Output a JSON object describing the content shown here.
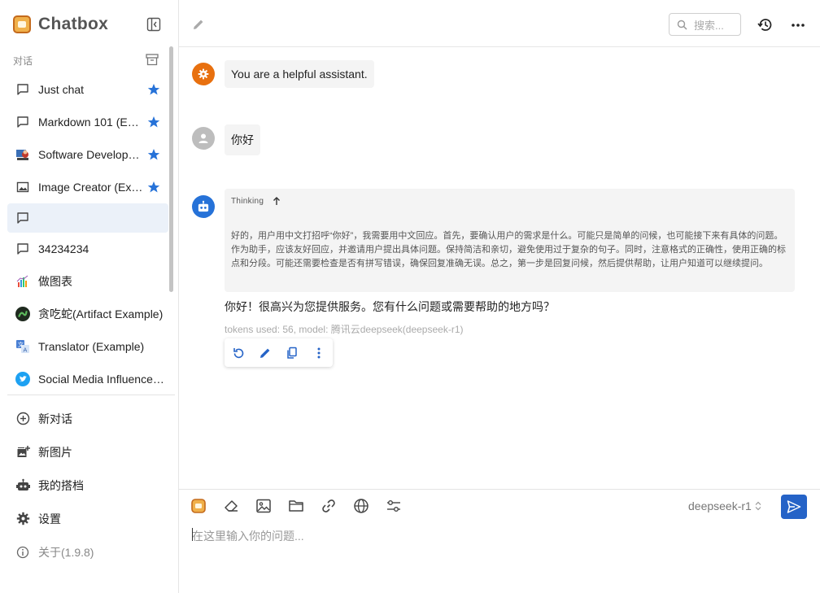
{
  "app": {
    "name": "Chatbox"
  },
  "sidebar": {
    "section_label": "对话",
    "conversations": [
      {
        "label": "Just chat",
        "icon": "chat-bubble-icon",
        "starred": true
      },
      {
        "label": "Markdown 101 (Example)",
        "icon": "chat-bubble-icon",
        "starred": true
      },
      {
        "label": "Software Developer (Example)",
        "icon": "developer-avatar-icon",
        "starred": true
      },
      {
        "label": "Image Creator (Example)",
        "icon": "image-icon",
        "starred": true
      },
      {
        "label": "",
        "icon": "chat-bubble-icon",
        "starred": false,
        "active": true
      },
      {
        "label": "34234234",
        "icon": "chat-bubble-icon",
        "starred": false
      },
      {
        "label": "做图表",
        "icon": "chart-avatar-icon",
        "starred": false
      },
      {
        "label": "贪吃蛇(Artifact Example)",
        "icon": "snake-avatar-icon",
        "starred": false
      },
      {
        "label": "Translator (Example)",
        "icon": "translator-avatar-icon",
        "starred": false
      },
      {
        "label": "Social Media Influencer (Example)",
        "icon": "twitter-avatar-icon",
        "starred": false
      }
    ],
    "menu": {
      "new_chat": "新对话",
      "new_image": "新图片",
      "my_copilots": "我的搭档",
      "settings": "设置",
      "about": "关于(1.9.8)"
    }
  },
  "header": {
    "search_placeholder": "搜索..."
  },
  "messages": {
    "system": "You are a helpful assistant.",
    "user": "你好",
    "assistant": {
      "thinking_label": "Thinking",
      "thinking": "好的，用户用中文打招呼“你好”，我需要用中文回应。首先，要确认用户的需求是什么。可能只是简单的问候，也可能接下来有具体的问题。作为助手，应该友好回应，并邀请用户提出具体问题。保持简洁和亲切，避免使用过于复杂的句子。同时，注意格式的正确性，使用正确的标点和分段。可能还需要检查是否有拼写错误，确保回复准确无误。总之，第一步是回复问候，然后提供帮助，让用户知道可以继续提问。",
      "answer": "你好！很高兴为您提供服务。您有什么问题或需要帮助的地方吗？",
      "meta": "tokens used: 56, model: 腾讯云deepseek(deepseek-r1)"
    }
  },
  "composer": {
    "model": "deepseek-r1",
    "placeholder": "在这里输入你的问题..."
  },
  "colors": {
    "accent": "#2563c7",
    "star": "#2672d8",
    "system_avatar": "#e8700f",
    "user_avatar": "#bdbdbd",
    "assistant_avatar": "#2672d8",
    "active_row": "#ebf1f9"
  }
}
